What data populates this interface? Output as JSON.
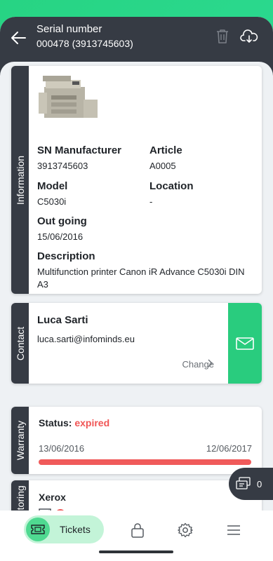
{
  "header": {
    "title": "Serial number",
    "subtitle": "000478 (3913745603)",
    "icons": [
      "back-arrow-icon",
      "trash-icon",
      "cloud-download-icon"
    ]
  },
  "information": {
    "side_label": "Information",
    "image": "printer-image",
    "sn_manufacturer_label": "SN Manufacturer",
    "sn_manufacturer_value": "3913745603",
    "article_label": "Article",
    "article_value": "A0005",
    "model_label": "Model",
    "model_value": "C5030i",
    "location_label": "Location",
    "location_value": "-",
    "outgoing_label": "Out going",
    "outgoing_value": "15/06/2016",
    "description_label": "Description",
    "description_value": "Multifunction printer Canon iR Advance C5030i DIN A3"
  },
  "contact": {
    "side_label": "Contact",
    "name": "Luca Sarti",
    "email": "luca.sarti@infominds.eu",
    "change_label": "Change",
    "action_color": "#29cc7e"
  },
  "warranty": {
    "side_label": "Warranty",
    "status_label": "Status:",
    "status_value": "expired",
    "start_date": "13/06/2016",
    "end_date": "12/06/2017",
    "progress": 1.0,
    "status_color": "#f05555"
  },
  "monitoring": {
    "side_label": "Monitoring",
    "name": "Xerox",
    "indicator_color": "#f05a5a"
  },
  "fab": {
    "count": "0"
  },
  "navbar": {
    "tickets_label": "Tickets",
    "items": [
      "tickets-icon",
      "lock-icon",
      "settings-icon",
      "menu-icon"
    ]
  },
  "colors": {
    "dark": "#363b44",
    "accent": "#29cc7e",
    "background": "#eef1f4"
  }
}
